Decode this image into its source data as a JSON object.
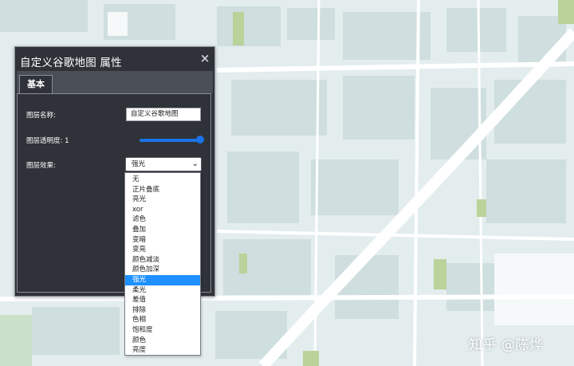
{
  "dialog": {
    "title": "自定义谷歌地图 属性",
    "close_glyph": "×",
    "tab_basic": "基本",
    "layer_name_label": "图层名称:",
    "layer_name_value": "自定义谷歌地图",
    "opacity_label": "图层透明度: 1",
    "opacity_value": 1,
    "effect_label": "图层效果:",
    "effect_selected": "强光",
    "select_arrow": "⌄"
  },
  "dropdown": {
    "options": [
      "无",
      "正片叠底",
      "亮光",
      "xor",
      "滤色",
      "叠加",
      "变暗",
      "变亮",
      "颜色减淡",
      "颜色加深",
      "强光",
      "柔光",
      "差值",
      "排除",
      "色相",
      "饱和度",
      "颜色",
      "亮度"
    ],
    "selected_index": 10
  },
  "watermark": "知乎 @陈烨",
  "colors": {
    "dialog_bg": "#2f3238",
    "accent": "#1a73e8",
    "selected_option": "#1e90ff"
  }
}
